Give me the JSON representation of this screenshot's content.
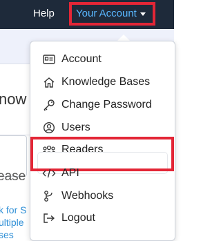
{
  "header": {
    "help_label": "Help",
    "account_label": "Your Account"
  },
  "background": {
    "heading_fragment": "now",
    "input_fragment": "ease",
    "link_lines": [
      "k for S",
      "ultiple",
      "ses"
    ]
  },
  "menu": {
    "items": [
      {
        "label": "Account",
        "icon": "id-card-icon"
      },
      {
        "label": "Knowledge Bases",
        "icon": "home-icon"
      },
      {
        "label": "Change Password",
        "icon": "key-icon"
      },
      {
        "label": "Users",
        "icon": "user-circle-icon"
      },
      {
        "label": "Readers",
        "icon": "readers-icon"
      },
      {
        "label": "API",
        "icon": "code-icon"
      },
      {
        "label": "Webhooks",
        "icon": "webhook-icon"
      },
      {
        "label": "Logout",
        "icon": "logout-icon"
      }
    ]
  },
  "colors": {
    "header_bg": "#1e2a3a",
    "account_link": "#59b7ff",
    "highlight_red": "#e32636"
  }
}
